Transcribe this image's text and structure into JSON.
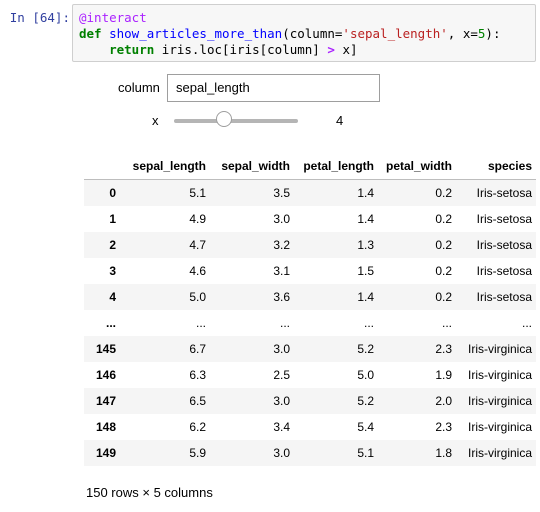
{
  "cell": {
    "prompt": "In [64]:",
    "code": {
      "decorator": "@interact",
      "def_kw": "def",
      "func_name": "show_articles_more_than",
      "params_open": "(column=",
      "param_str": "'sepal_length'",
      "params_mid": ", x=",
      "param_num": "5",
      "params_close": "):",
      "return_kw": "return",
      "return_expr_a": "iris.loc[iris[column]",
      "return_op": ">",
      "return_expr_b": "x]"
    }
  },
  "widgets": {
    "column_label": "column",
    "column_value": "sepal_length",
    "x_label": "x",
    "x_value": "4",
    "slider": {
      "min": 0,
      "max": 10,
      "value": 4
    }
  },
  "table": {
    "columns": [
      "sepal_length",
      "sepal_width",
      "petal_length",
      "petal_width",
      "species"
    ],
    "rows": [
      [
        "0",
        "5.1",
        "3.5",
        "1.4",
        "0.2",
        "Iris-setosa"
      ],
      [
        "1",
        "4.9",
        "3.0",
        "1.4",
        "0.2",
        "Iris-setosa"
      ],
      [
        "2",
        "4.7",
        "3.2",
        "1.3",
        "0.2",
        "Iris-setosa"
      ],
      [
        "3",
        "4.6",
        "3.1",
        "1.5",
        "0.2",
        "Iris-setosa"
      ],
      [
        "4",
        "5.0",
        "3.6",
        "1.4",
        "0.2",
        "Iris-setosa"
      ],
      [
        "...",
        "...",
        "...",
        "...",
        "...",
        "..."
      ],
      [
        "145",
        "6.7",
        "3.0",
        "5.2",
        "2.3",
        "Iris-virginica"
      ],
      [
        "146",
        "6.3",
        "2.5",
        "5.0",
        "1.9",
        "Iris-virginica"
      ],
      [
        "147",
        "6.5",
        "3.0",
        "5.2",
        "2.0",
        "Iris-virginica"
      ],
      [
        "148",
        "6.2",
        "3.4",
        "5.4",
        "2.3",
        "Iris-virginica"
      ],
      [
        "149",
        "5.9",
        "3.0",
        "5.1",
        "1.8",
        "Iris-virginica"
      ]
    ],
    "footer": "150 rows × 5 columns"
  }
}
